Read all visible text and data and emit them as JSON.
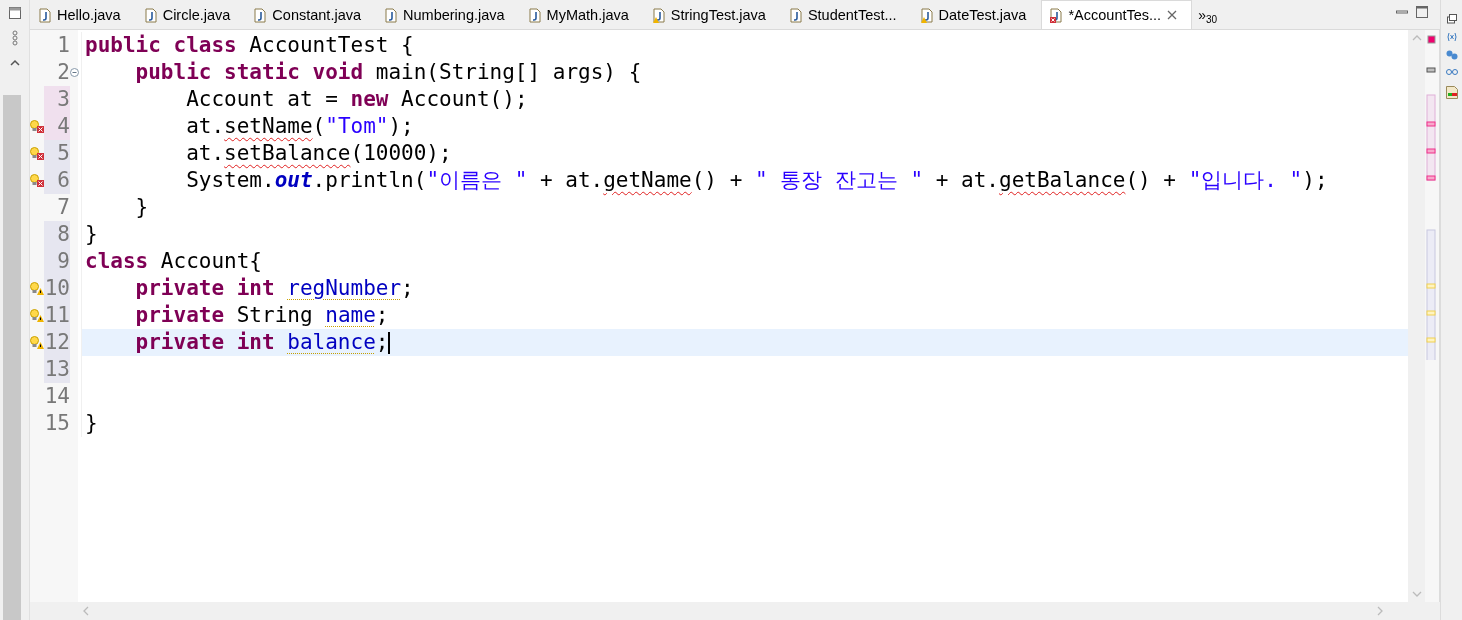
{
  "tabs": [
    {
      "label": "Hello.java",
      "warning": false,
      "error": false,
      "selected": false
    },
    {
      "label": "Circle.java",
      "warning": false,
      "error": false,
      "selected": false
    },
    {
      "label": "Constant.java",
      "warning": false,
      "error": false,
      "selected": false
    },
    {
      "label": "Numbering.java",
      "warning": false,
      "error": false,
      "selected": false
    },
    {
      "label": "MyMath.java",
      "warning": false,
      "error": false,
      "selected": false
    },
    {
      "label": "StringTest.java",
      "warning": true,
      "error": false,
      "selected": false
    },
    {
      "label": "StudentTest...",
      "warning": false,
      "error": false,
      "selected": false
    },
    {
      "label": "DateTest.java",
      "warning": true,
      "error": false,
      "selected": false
    },
    {
      "label": "*AccountTes...",
      "warning": false,
      "error": true,
      "selected": true
    }
  ],
  "overflow": {
    "symbol": "»",
    "count": "30"
  },
  "lines": [
    {
      "number": "1",
      "warning": false,
      "error": false,
      "added": false,
      "changed": false,
      "current": false,
      "tokens": [
        {
          "kind": "keyword",
          "text": "public class"
        },
        {
          "kind": "plain",
          "text": " AccountTest {"
        }
      ]
    },
    {
      "number": "2",
      "warning": false,
      "error": false,
      "added": false,
      "changed": false,
      "current": false,
      "expanded": true,
      "tokens": [
        {
          "kind": "keyword",
          "text": "    public static void"
        },
        {
          "kind": "plain",
          "text": " main(String[] args) {"
        }
      ]
    },
    {
      "number": "3",
      "warning": false,
      "error": false,
      "added": true,
      "changed": false,
      "current": false,
      "tokens": [
        {
          "kind": "plain",
          "text": "        Account at = "
        },
        {
          "kind": "keyword",
          "text": "new"
        },
        {
          "kind": "plain",
          "text": " Account();"
        }
      ]
    },
    {
      "number": "4",
      "warning": false,
      "error": true,
      "added": true,
      "changed": false,
      "current": false,
      "tokens": [
        {
          "kind": "plain",
          "text": "        at."
        },
        {
          "kind": "unresolved",
          "text": "setName"
        },
        {
          "kind": "plain",
          "text": "("
        },
        {
          "kind": "string",
          "text": "\"Tom\""
        },
        {
          "kind": "plain",
          "text": ");"
        }
      ]
    },
    {
      "number": "5",
      "warning": false,
      "error": true,
      "added": false,
      "changed": true,
      "current": false,
      "tokens": [
        {
          "kind": "plain",
          "text": "        at."
        },
        {
          "kind": "unresolved",
          "text": "setBalance"
        },
        {
          "kind": "plain",
          "text": "(10000);"
        }
      ]
    },
    {
      "number": "6",
      "warning": false,
      "error": true,
      "added": false,
      "changed": true,
      "current": false,
      "tokens": [
        {
          "kind": "plain",
          "text": "        System."
        },
        {
          "kind": "static-field",
          "text": "out"
        },
        {
          "kind": "plain",
          "text": ".println("
        },
        {
          "kind": "string",
          "text": "\"이름은 \""
        },
        {
          "kind": "plain",
          "text": " + at."
        },
        {
          "kind": "unresolved",
          "text": "getName"
        },
        {
          "kind": "plain",
          "text": "() + "
        },
        {
          "kind": "string",
          "text": "\" 통장 잔고는 \""
        },
        {
          "kind": "plain",
          "text": " + at."
        },
        {
          "kind": "unresolved",
          "text": "getBalance"
        },
        {
          "kind": "plain",
          "text": "() + "
        },
        {
          "kind": "string",
          "text": "\"입니다. \""
        },
        {
          "kind": "plain",
          "text": ");"
        }
      ]
    },
    {
      "number": "7",
      "warning": false,
      "error": false,
      "added": false,
      "changed": false,
      "current": false,
      "tokens": [
        {
          "kind": "plain",
          "text": "    }"
        }
      ]
    },
    {
      "number": "8",
      "warning": false,
      "error": false,
      "added": false,
      "changed": true,
      "current": false,
      "tokens": [
        {
          "kind": "plain",
          "text": "}"
        }
      ]
    },
    {
      "number": "9",
      "warning": false,
      "error": false,
      "added": false,
      "changed": true,
      "current": false,
      "tokens": [
        {
          "kind": "keyword",
          "text": "class"
        },
        {
          "kind": "plain",
          "text": " Account{"
        }
      ]
    },
    {
      "number": "10",
      "warning": true,
      "error": false,
      "added": false,
      "changed": true,
      "current": false,
      "tokens": [
        {
          "kind": "keyword",
          "text": "    private int "
        },
        {
          "kind": "unused-field",
          "text": "regNumber"
        },
        {
          "kind": "plain",
          "text": ";"
        }
      ]
    },
    {
      "number": "11",
      "warning": true,
      "error": false,
      "added": false,
      "changed": true,
      "current": false,
      "tokens": [
        {
          "kind": "keyword",
          "text": "    private"
        },
        {
          "kind": "plain",
          "text": " String "
        },
        {
          "kind": "unused-field",
          "text": "name"
        },
        {
          "kind": "plain",
          "text": ";"
        }
      ]
    },
    {
      "number": "12",
      "warning": true,
      "error": false,
      "added": false,
      "changed": true,
      "current": true,
      "tokens": [
        {
          "kind": "keyword",
          "text": "    private int "
        },
        {
          "kind": "unused-field",
          "text": "balance"
        },
        {
          "kind": "plain",
          "text": ";"
        }
      ]
    },
    {
      "number": "13",
      "warning": false,
      "error": false,
      "added": false,
      "changed": true,
      "current": false
    },
    {
      "number": "14",
      "warning": false,
      "error": false,
      "added": false,
      "changed": false,
      "current": false
    },
    {
      "number": "15",
      "warning": false,
      "error": false,
      "added": false,
      "changed": false,
      "current": false,
      "tokens": [
        {
          "kind": "plain",
          "text": "}"
        }
      ]
    }
  ]
}
